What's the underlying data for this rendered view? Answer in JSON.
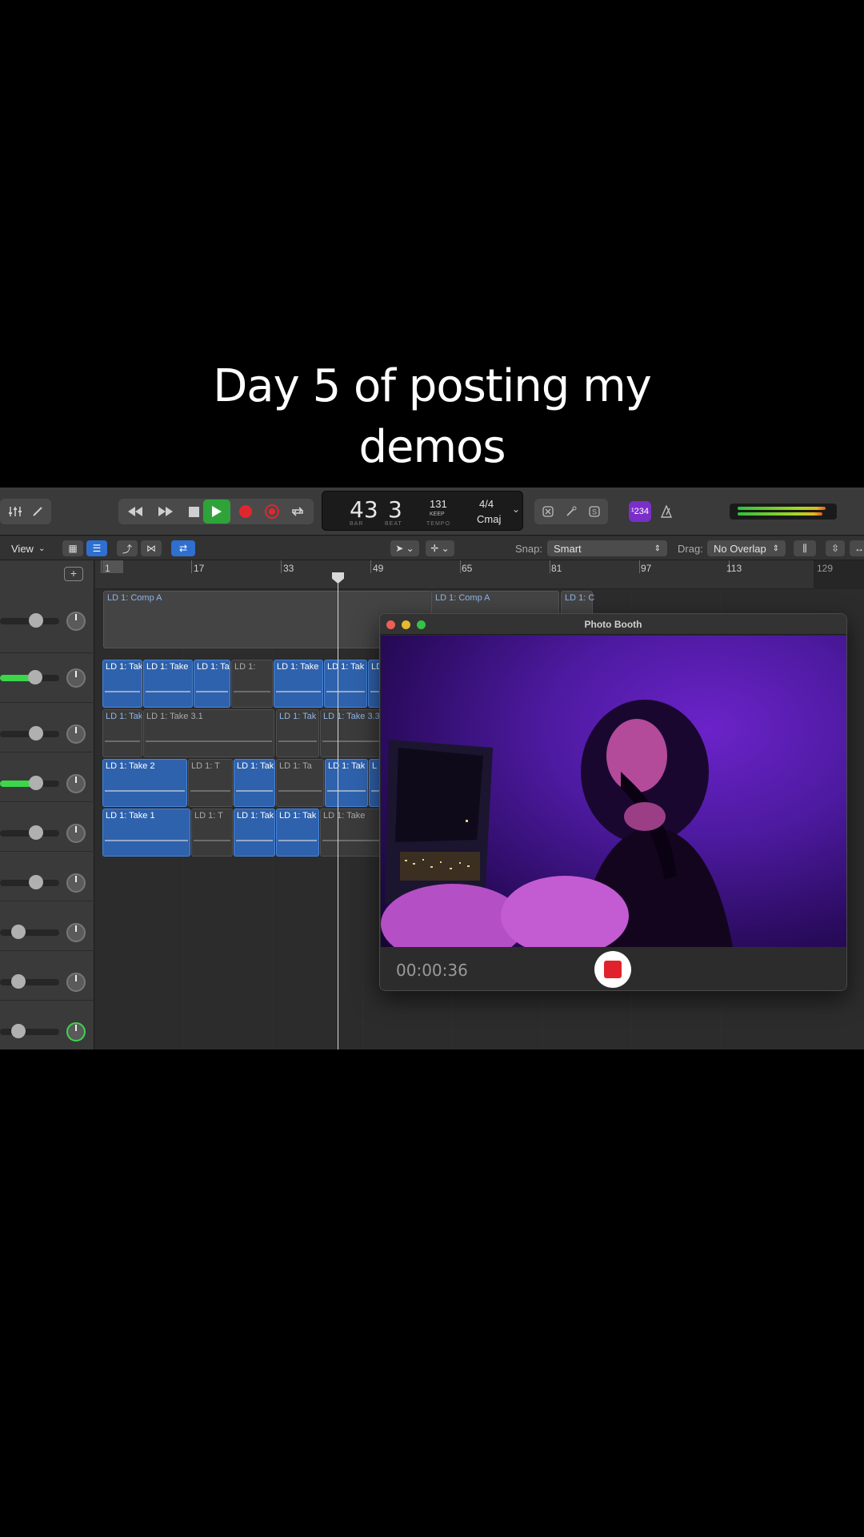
{
  "caption": {
    "line1": "Day 5 of posting my",
    "line2": "demos"
  },
  "lcd": {
    "bar": "43",
    "beat": "3",
    "bar_label": "BAR",
    "beat_label": "BEAT",
    "tempo": "131",
    "tempo_mode": "KEEP",
    "tempo_label": "TEMPO",
    "signature": "4/4",
    "key": "Cmaj"
  },
  "count_in": "¹234",
  "toolbar": {
    "view_label": "View",
    "snap_label": "Snap:",
    "snap_value": "Smart",
    "drag_label": "Drag:",
    "drag_value": "No Overlap"
  },
  "ruler": {
    "markers": [
      "1",
      "17",
      "33",
      "49",
      "65",
      "81",
      "97",
      "113"
    ],
    "end_marker": "129"
  },
  "regions": {
    "comp_a": "LD 1: Comp A",
    "comp_a2": "LD 1: Comp A",
    "comp_c": "LD 1: C",
    "r2": [
      "LD 1: Tak",
      "LD 1: Take",
      "LD 1: Ta",
      "LD 1:",
      "LD 1: Take",
      "LD 1: Tak",
      "LD"
    ],
    "r3": [
      "LD 1: Tak",
      "LD 1: Take 3.1",
      "LD 1: Tak",
      "LD 1: Take 3.3"
    ],
    "r4": [
      "LD 1: Take 2",
      "LD 1: T",
      "LD 1: Tak",
      "LD 1: Ta",
      "LD 1: Tak",
      "L"
    ],
    "r5": [
      "LD 1: Take 1",
      "LD 1: T",
      "LD 1: Tak",
      "LD 1: Tak",
      "LD 1: Take"
    ]
  },
  "photo_booth": {
    "title": "Photo Booth",
    "timer": "00:00:36"
  },
  "colors": {
    "region_blue": "#2f62ad",
    "accent_green": "#2fa33a",
    "record_red": "#e0272e",
    "video_purple": "#5a1fb5"
  }
}
